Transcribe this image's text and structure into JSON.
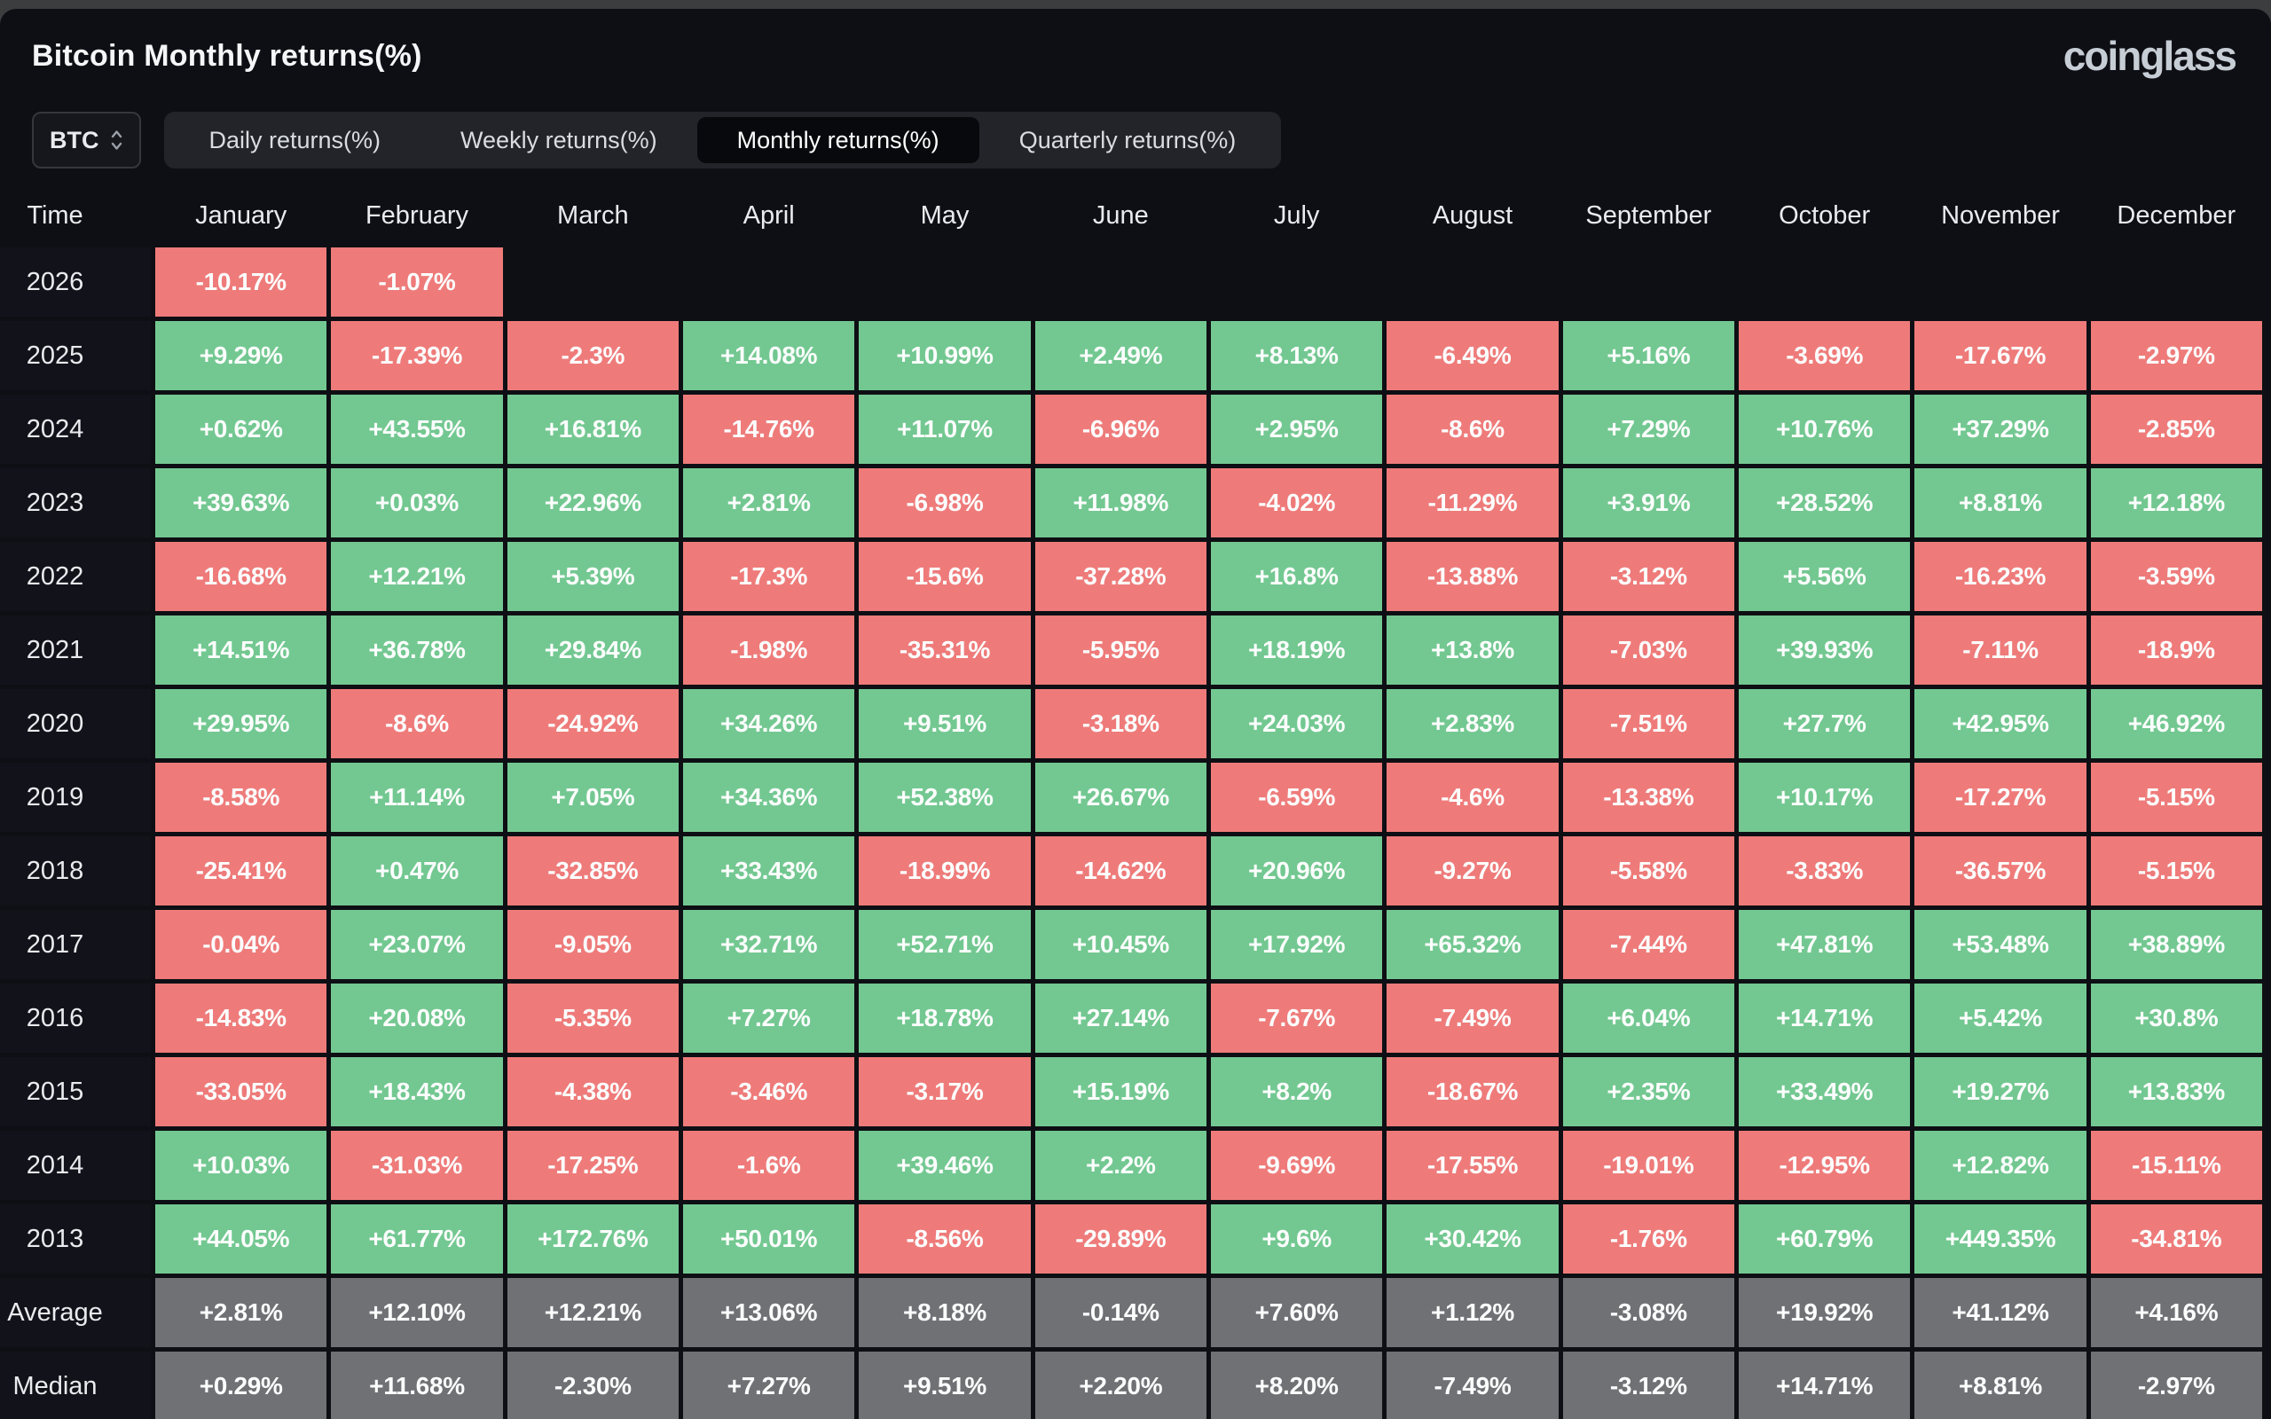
{
  "header": {
    "title": "Bitcoin Monthly returns(%)",
    "logo": "coinglass"
  },
  "controls": {
    "coin_select": {
      "label": "BTC",
      "icon": "sort-arrows"
    },
    "tabs": [
      {
        "label": "Daily returns(%)",
        "active": false
      },
      {
        "label": "Weekly returns(%)",
        "active": false
      },
      {
        "label": "Monthly returns(%)",
        "active": true
      },
      {
        "label": "Quarterly returns(%)",
        "active": false
      }
    ]
  },
  "colors": {
    "positive": "#73c891",
    "negative": "#ee7b7a",
    "summary": "#6f7175",
    "background": "#0e0f14"
  },
  "table": {
    "time_header": "Time",
    "months": [
      "January",
      "February",
      "March",
      "April",
      "May",
      "June",
      "July",
      "August",
      "September",
      "October",
      "November",
      "December"
    ],
    "rows": [
      {
        "label": "2026",
        "summary": false,
        "cells": [
          "-10.17%",
          "-1.07%",
          "",
          "",
          "",
          "",
          "",
          "",
          "",
          "",
          "",
          ""
        ]
      },
      {
        "label": "2025",
        "summary": false,
        "cells": [
          "+9.29%",
          "-17.39%",
          "-2.3%",
          "+14.08%",
          "+10.99%",
          "+2.49%",
          "+8.13%",
          "-6.49%",
          "+5.16%",
          "-3.69%",
          "-17.67%",
          "-2.97%"
        ]
      },
      {
        "label": "2024",
        "summary": false,
        "cells": [
          "+0.62%",
          "+43.55%",
          "+16.81%",
          "-14.76%",
          "+11.07%",
          "-6.96%",
          "+2.95%",
          "-8.6%",
          "+7.29%",
          "+10.76%",
          "+37.29%",
          "-2.85%"
        ]
      },
      {
        "label": "2023",
        "summary": false,
        "cells": [
          "+39.63%",
          "+0.03%",
          "+22.96%",
          "+2.81%",
          "-6.98%",
          "+11.98%",
          "-4.02%",
          "-11.29%",
          "+3.91%",
          "+28.52%",
          "+8.81%",
          "+12.18%"
        ]
      },
      {
        "label": "2022",
        "summary": false,
        "cells": [
          "-16.68%",
          "+12.21%",
          "+5.39%",
          "-17.3%",
          "-15.6%",
          "-37.28%",
          "+16.8%",
          "-13.88%",
          "-3.12%",
          "+5.56%",
          "-16.23%",
          "-3.59%"
        ]
      },
      {
        "label": "2021",
        "summary": false,
        "cells": [
          "+14.51%",
          "+36.78%",
          "+29.84%",
          "-1.98%",
          "-35.31%",
          "-5.95%",
          "+18.19%",
          "+13.8%",
          "-7.03%",
          "+39.93%",
          "-7.11%",
          "-18.9%"
        ]
      },
      {
        "label": "2020",
        "summary": false,
        "cells": [
          "+29.95%",
          "-8.6%",
          "-24.92%",
          "+34.26%",
          "+9.51%",
          "-3.18%",
          "+24.03%",
          "+2.83%",
          "-7.51%",
          "+27.7%",
          "+42.95%",
          "+46.92%"
        ]
      },
      {
        "label": "2019",
        "summary": false,
        "cells": [
          "-8.58%",
          "+11.14%",
          "+7.05%",
          "+34.36%",
          "+52.38%",
          "+26.67%",
          "-6.59%",
          "-4.6%",
          "-13.38%",
          "+10.17%",
          "-17.27%",
          "-5.15%"
        ]
      },
      {
        "label": "2018",
        "summary": false,
        "cells": [
          "-25.41%",
          "+0.47%",
          "-32.85%",
          "+33.43%",
          "-18.99%",
          "-14.62%",
          "+20.96%",
          "-9.27%",
          "-5.58%",
          "-3.83%",
          "-36.57%",
          "-5.15%"
        ]
      },
      {
        "label": "2017",
        "summary": false,
        "cells": [
          "-0.04%",
          "+23.07%",
          "-9.05%",
          "+32.71%",
          "+52.71%",
          "+10.45%",
          "+17.92%",
          "+65.32%",
          "-7.44%",
          "+47.81%",
          "+53.48%",
          "+38.89%"
        ]
      },
      {
        "label": "2016",
        "summary": false,
        "cells": [
          "-14.83%",
          "+20.08%",
          "-5.35%",
          "+7.27%",
          "+18.78%",
          "+27.14%",
          "-7.67%",
          "-7.49%",
          "+6.04%",
          "+14.71%",
          "+5.42%",
          "+30.8%"
        ]
      },
      {
        "label": "2015",
        "summary": false,
        "cells": [
          "-33.05%",
          "+18.43%",
          "-4.38%",
          "-3.46%",
          "-3.17%",
          "+15.19%",
          "+8.2%",
          "-18.67%",
          "+2.35%",
          "+33.49%",
          "+19.27%",
          "+13.83%"
        ]
      },
      {
        "label": "2014",
        "summary": false,
        "cells": [
          "+10.03%",
          "-31.03%",
          "-17.25%",
          "-1.6%",
          "+39.46%",
          "+2.2%",
          "-9.69%",
          "-17.55%",
          "-19.01%",
          "-12.95%",
          "+12.82%",
          "-15.11%"
        ]
      },
      {
        "label": "2013",
        "summary": false,
        "cells": [
          "+44.05%",
          "+61.77%",
          "+172.76%",
          "+50.01%",
          "-8.56%",
          "-29.89%",
          "+9.6%",
          "+30.42%",
          "-1.76%",
          "+60.79%",
          "+449.35%",
          "-34.81%"
        ]
      },
      {
        "label": "Average",
        "summary": true,
        "cells": [
          "+2.81%",
          "+12.10%",
          "+12.21%",
          "+13.06%",
          "+8.18%",
          "-0.14%",
          "+7.60%",
          "+1.12%",
          "-3.08%",
          "+19.92%",
          "+41.12%",
          "+4.16%"
        ]
      },
      {
        "label": "Median",
        "summary": true,
        "cells": [
          "+0.29%",
          "+11.68%",
          "-2.30%",
          "+7.27%",
          "+9.51%",
          "+2.20%",
          "+8.20%",
          "-7.49%",
          "-3.12%",
          "+14.71%",
          "+8.81%",
          "-2.97%"
        ]
      }
    ]
  }
}
